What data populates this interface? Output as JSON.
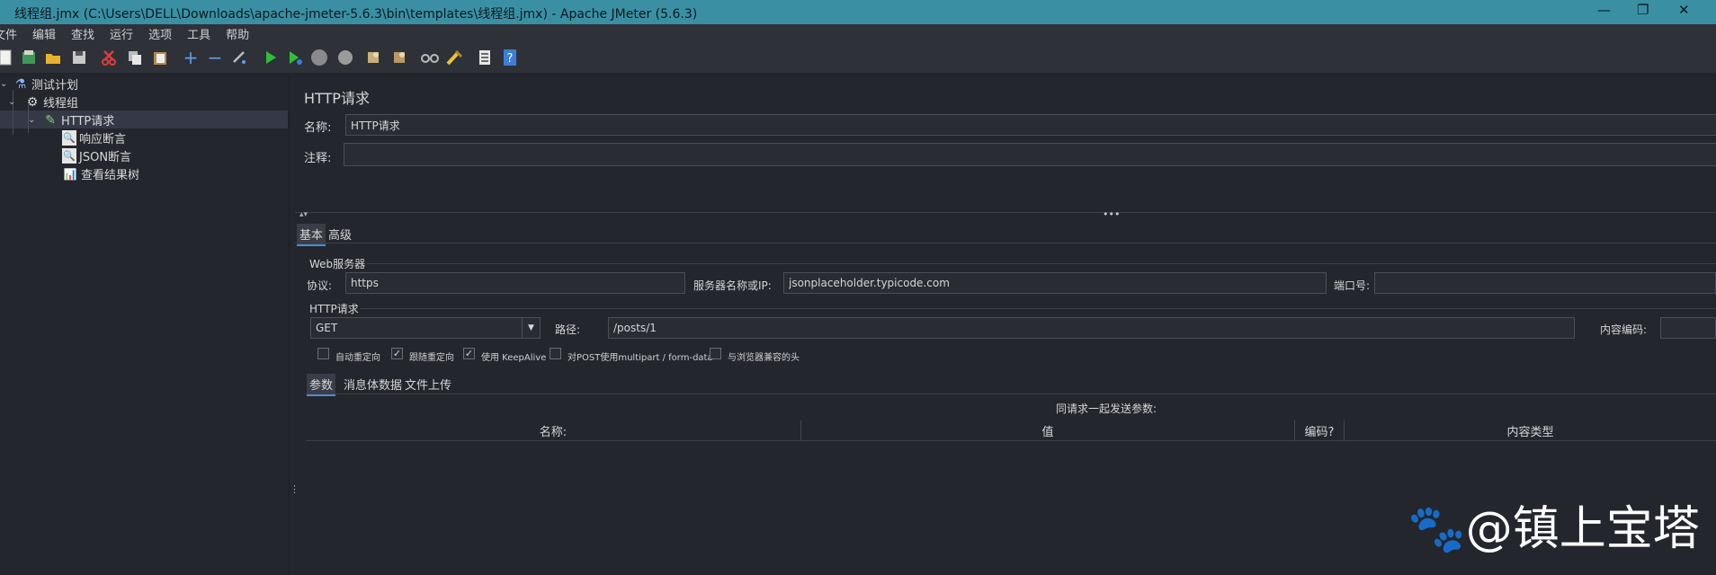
{
  "window": {
    "title": "线程组.jmx (C:\\Users\\DELL\\Downloads\\apache-jmeter-5.6.3\\bin\\templates\\线程组.jmx) - Apache JMeter (5.6.3)",
    "minimize": "—",
    "restore": "❐",
    "close": "✕"
  },
  "menu": [
    "文件",
    "编辑",
    "查找",
    "运行",
    "选项",
    "工具",
    "帮助"
  ],
  "toolbar_icons": [
    "new-icon",
    "templates-icon",
    "open-icon",
    "save-icon",
    "cut-icon",
    "copy-icon",
    "paste-icon",
    "expand-icon",
    "collapse-icon",
    "toggle-icon",
    "start-icon",
    "start-no-pauses-icon",
    "stop-icon",
    "shutdown-icon",
    "clear-icon",
    "clear-all-icon",
    "search-icon",
    "reset-search-icon",
    "function-helper-icon",
    "help-icon"
  ],
  "tree": {
    "items": [
      {
        "label": "测试计划",
        "icon": "test-plan-icon"
      },
      {
        "label": "线程组",
        "icon": "thread-group-icon"
      },
      {
        "label": "HTTP请求",
        "icon": "http-sampler-icon"
      },
      {
        "label": "响应断言",
        "icon": "assertion-icon"
      },
      {
        "label": "JSON断言",
        "icon": "json-assertion-icon"
      },
      {
        "label": "查看结果树",
        "icon": "result-tree-icon"
      }
    ]
  },
  "panel": {
    "title": "HTTP请求",
    "name_label": "名称:",
    "name_value": "HTTP请求",
    "comment_label": "注释:",
    "comment_value": "",
    "tabs": [
      "基本",
      "高级"
    ],
    "web_server": {
      "group_label": "Web服务器",
      "protocol_label": "协议:",
      "protocol_value": "https",
      "server_label": "服务器名称或IP:",
      "server_value": "jsonplaceholder.typicode.com",
      "port_label": "端口号:",
      "port_value": ""
    },
    "http_request": {
      "group_label": "HTTP请求",
      "method": "GET",
      "path_label": "路径:",
      "path_value": "/posts/1",
      "encoding_label": "内容编码:",
      "encoding_value": ""
    },
    "checkboxes": [
      {
        "label": "自动重定向",
        "checked": false
      },
      {
        "label": "跟随重定向",
        "checked": true
      },
      {
        "label": "使用 KeepAlive",
        "checked": true
      },
      {
        "label": "对POST使用multipart / form-data",
        "checked": false
      },
      {
        "label": "与浏览器兼容的头",
        "checked": false
      }
    ],
    "sub_tabs": [
      "参数",
      "消息体数据",
      "文件上传"
    ],
    "params_caption": "同请求一起发送参数:",
    "table_headers": [
      "名称:",
      "值",
      "编码?",
      "内容类型"
    ]
  },
  "watermark": "🐾@镇上宝塔"
}
